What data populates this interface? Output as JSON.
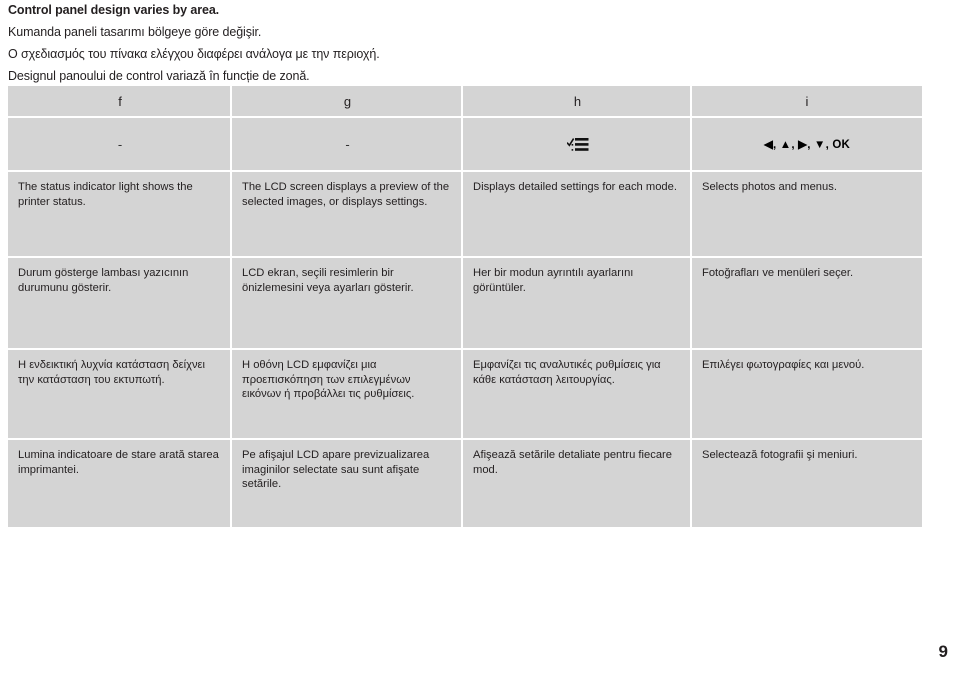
{
  "intro": {
    "en": "Control panel design varies by area.",
    "tr": "Kumanda paneli tasarımı bölgeye göre değişir.",
    "el": "Ο σχεδιασμός του πίνακα ελέγχου διαφέρει ανάλογα με την περιοχή.",
    "ro": "Designul panoului de control variază în funcție de zonă."
  },
  "table": {
    "headers": [
      "f",
      "g",
      "h",
      "i"
    ],
    "icons": [
      {
        "type": "dash",
        "label": "-"
      },
      {
        "type": "dash",
        "label": "-"
      },
      {
        "type": "checklist-icon",
        "label": ""
      },
      {
        "type": "text",
        "label": "◀, ▲, ▶, ▼, OK"
      }
    ],
    "rows": [
      {
        "lang": "en",
        "cells": [
          "The status indicator light shows the printer status.",
          "The LCD screen displays a preview of the selected images, or displays settings.",
          "Displays detailed settings for each mode.",
          "Selects photos and menus."
        ]
      },
      {
        "lang": "tr",
        "cells": [
          "Durum gösterge lambası yazıcının durumunu gösterir.",
          "LCD ekran, seçili resimlerin bir önizlemesini veya ayarları gösterir.",
          "Her bir modun ayrıntılı ayarlarını görüntüler.",
          "Fotoğrafları ve menüleri seçer."
        ]
      },
      {
        "lang": "el",
        "cells": [
          "Η ενδεικτική λυχνία κατάσταση δείχνει την κατάσταση του εκτυπωτή.",
          "Η οθόνη LCD εμφανίζει μια προεπισκόπηση των επιλεγμένων εικόνων ή προβάλλει τις ρυθμίσεις.",
          "Εμφανίζει τις αναλυτικές ρυθμίσεις για κάθε κατάσταση λειτουργίας.",
          "Επιλέγει φωτογραφίες και μενού."
        ]
      },
      {
        "lang": "ro",
        "cells": [
          "Lumina indicatoare de stare arată starea imprimantei.",
          "Pe afişajul LCD apare previzualizarea imaginilor selectate sau sunt afişate setările.",
          "Afişează setările detaliate pentru fiecare mod.",
          "Selectează fotografii şi meniuri."
        ]
      }
    ]
  },
  "footer": {
    "page_number": "9"
  },
  "colors": {
    "table_background": "#d4d4d4",
    "grid_line": "#ffffff",
    "text": "#231f20",
    "page_background": "#ffffff"
  }
}
